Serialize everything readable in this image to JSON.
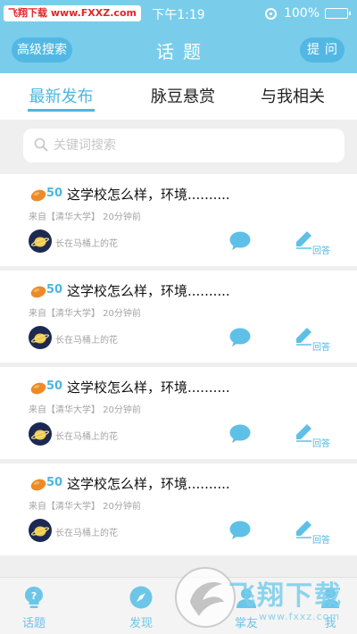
{
  "status_bar": {
    "watermark": "飞翔下载 www.FXXZ.com",
    "time": "下午1:19",
    "battery": "100%",
    "battery_level": 1.0
  },
  "nav": {
    "left_button": "高级搜索",
    "title": "话题",
    "right_button": "提问"
  },
  "tabs": [
    {
      "label": "最新发布",
      "active": true
    },
    {
      "label": "脉豆悬赏",
      "active": false
    },
    {
      "label": "与我相关",
      "active": false
    }
  ],
  "search": {
    "placeholder": "关键词搜索"
  },
  "questions": [
    {
      "points": "50",
      "title": "这学校怎么样，环境..........",
      "meta": "来自【清华大学】 20分钟前",
      "user": "长在马桶上的花",
      "answer_label": "回答"
    },
    {
      "points": "50",
      "title": "这学校怎么样，环境..........",
      "meta": "来自【清华大学】 20分钟前",
      "user": "长在马桶上的花",
      "answer_label": "回答"
    },
    {
      "points": "50",
      "title": "这学校怎么样，环境..........",
      "meta": "来自【清华大学】 20分钟前",
      "user": "长在马桶上的花",
      "answer_label": "回答"
    },
    {
      "points": "50",
      "title": "这学校怎么样，环境..........",
      "meta": "来自【清华大学】 20分钟前",
      "user": "长在马桶上的花",
      "answer_label": "回答"
    }
  ],
  "tab_bar": [
    {
      "label": "话题",
      "icon": "lightbulb-icon"
    },
    {
      "label": "发现",
      "icon": "compass-icon"
    },
    {
      "label": "掌友",
      "icon": "friends-icon"
    },
    {
      "label": "我",
      "icon": "person-icon"
    }
  ],
  "overlay": {
    "brand": "飞翔下载",
    "url": "www.fxxz.com"
  },
  "colors": {
    "accent": "#4bb7e0",
    "header": "#79cdea"
  }
}
